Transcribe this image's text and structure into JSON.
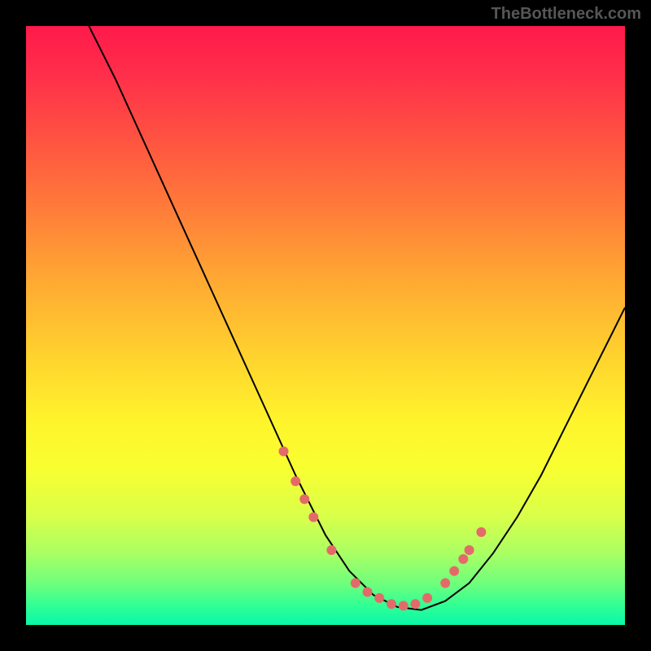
{
  "watermark": "TheBottleneck.com",
  "colors": {
    "page_bg": "#000000",
    "watermark_text": "#565656",
    "curve_stroke": "#000000",
    "dot_fill": "#e46a6a",
    "gradient_top": "#ff1a4b",
    "gradient_bottom": "#09f7a9"
  },
  "chart_data": {
    "type": "line",
    "title": "",
    "xlabel": "",
    "ylabel": "",
    "xlim": [
      0,
      100
    ],
    "ylim": [
      0,
      100
    ],
    "grid": false,
    "legend": false,
    "notes": "No numeric axis ticks are rendered; values are relative positions read off the plot (0–100 on each axis). Curve is a V shape with the steep descending left branch starting near the top-left and a shallower ascending right branch. Red dots cluster near the valley between x≈43 and x≈73.",
    "series": [
      {
        "name": "curve",
        "x": [
          10.5,
          15,
          20,
          25,
          30,
          35,
          40,
          45,
          50,
          54,
          58,
          62,
          66,
          70,
          74,
          78,
          82,
          86,
          90,
          94,
          98,
          100
        ],
        "y": [
          100,
          91,
          80,
          69,
          58,
          47,
          36,
          25,
          15,
          9,
          5,
          3,
          2.5,
          4,
          7,
          12,
          18,
          25,
          33,
          41,
          49,
          53
        ]
      }
    ],
    "dots": [
      {
        "x": 43,
        "y": 29
      },
      {
        "x": 45,
        "y": 24
      },
      {
        "x": 46.5,
        "y": 21
      },
      {
        "x": 48,
        "y": 18
      },
      {
        "x": 51,
        "y": 12.5
      },
      {
        "x": 55,
        "y": 7
      },
      {
        "x": 57,
        "y": 5.5
      },
      {
        "x": 59,
        "y": 4.5
      },
      {
        "x": 61,
        "y": 3.5
      },
      {
        "x": 63,
        "y": 3.2
      },
      {
        "x": 65,
        "y": 3.5
      },
      {
        "x": 67,
        "y": 4.5
      },
      {
        "x": 70,
        "y": 7
      },
      {
        "x": 71.5,
        "y": 9
      },
      {
        "x": 73,
        "y": 11
      },
      {
        "x": 74,
        "y": 12.5
      },
      {
        "x": 76,
        "y": 15.5
      }
    ]
  }
}
